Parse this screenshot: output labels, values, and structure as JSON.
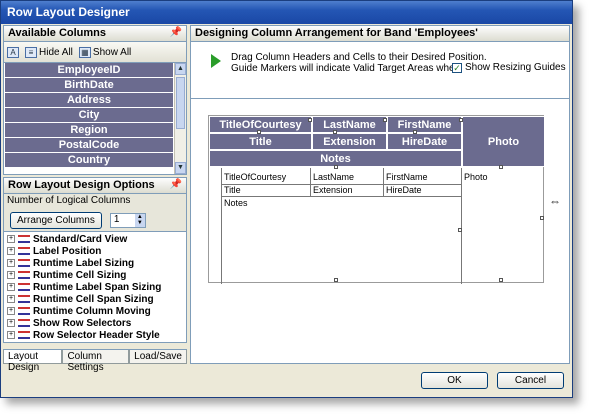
{
  "window": {
    "title": "Row Layout Designer"
  },
  "available_columns": {
    "title": "Available Columns",
    "hide_all_label": "Hide All",
    "show_all_label": "Show All",
    "items": [
      "EmployeeID",
      "BirthDate",
      "Address",
      "City",
      "Region",
      "PostalCode",
      "Country"
    ]
  },
  "options": {
    "title": "Row Layout Design Options",
    "logical_columns_label": "Number of Logical Columns",
    "arrange_label": "Arrange Columns",
    "logical_columns_value": "1",
    "tree": [
      "Standard/Card View",
      "Label Position",
      "Runtime Label Sizing",
      "Runtime Cell Sizing",
      "Runtime Label Span Sizing",
      "Runtime Cell Span Sizing",
      "Runtime Column Moving",
      "Show Row Selectors",
      "Row Selector Header Style"
    ]
  },
  "tabs": [
    "Layout Design",
    "Column Settings",
    "Load/Save"
  ],
  "designer": {
    "title": "Designing Column Arrangement for Band 'Employees'",
    "instr_line1": "Drag Column Headers and Cells to their Desired Position.",
    "instr_line2": "Guide Markers will indicate Valid Target Areas where the Item",
    "show_guides_label": "Show Resizing Guides",
    "headers": {
      "title_of_courtesy": "TitleOfCourtesy",
      "last_name": "LastName",
      "first_name": "FirstName",
      "title": "Title",
      "extension": "Extension",
      "hire_date": "HireDate",
      "photo": "Photo",
      "notes": "Notes"
    },
    "cells": {
      "title_of_courtesy": "TitleOfCourtesy",
      "last_name": "LastName",
      "first_name": "FirstName",
      "photo": "Photo",
      "title": "Title",
      "extension": "Extension",
      "hire_date": "HireDate",
      "notes": "Notes"
    }
  },
  "buttons": {
    "ok": "OK",
    "cancel": "Cancel"
  }
}
